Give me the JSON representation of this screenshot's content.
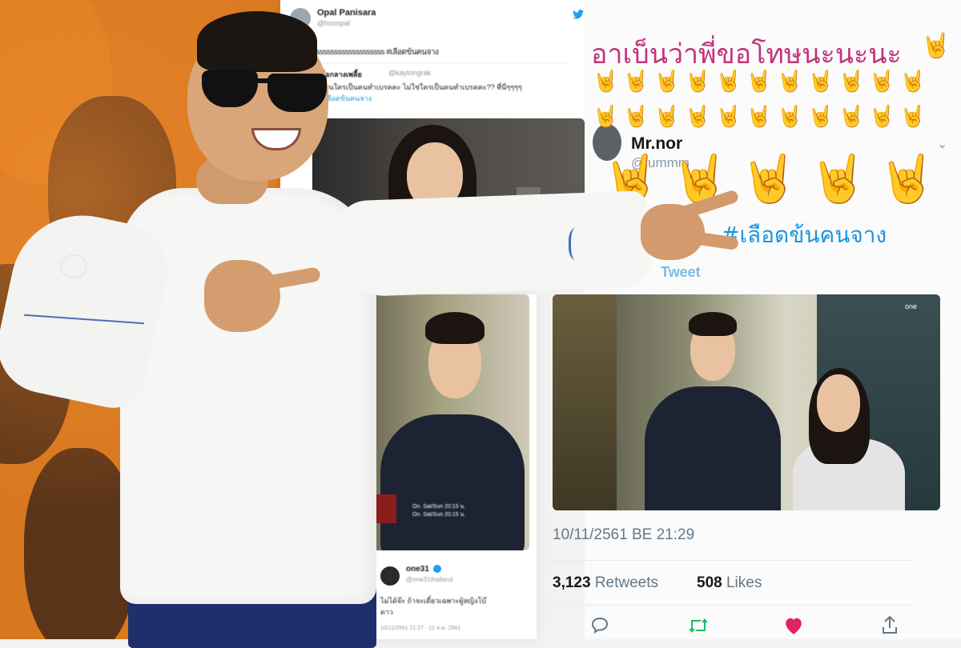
{
  "tweet_top": {
    "author_name": "Opal Panisara",
    "author_handle": "@hooopal",
    "text_line": "ssssssssssssssssssss #เลือดข้นคนจาง",
    "reply_author": "ชื่อกลางเพลี้ย",
    "reply_handle": "@kaytongrak",
    "reply_line1": "ไหนใครเป็นคนทำเบรคคะ ไม่ใช่ใครเป็นคนทำเบรคคะ?? ที่นี่ๆๆๆๆ",
    "reply_line2": "#เลือดข้นคนจาง"
  },
  "tweet_right": {
    "header_text": "อาเบ็นว่าพี่ขอโทษนะนะนะ",
    "author_name": "Mr.nor",
    "author_handle": "@lummm",
    "hashtag": "#เลือดข้นคนจาง",
    "translate": "Tweet",
    "timestamp": "10/11/2561 BE 21:29",
    "retweets_count": "3,123",
    "retweets_label": "Retweets",
    "likes_count": "508",
    "likes_label": "Likes"
  },
  "tweet_mid": {
    "author_name": "one31",
    "author_handle": "@one31thailand",
    "text_line1": "ไม่ได้จ๊ะ ถ้าจะเดี๋ยวเฉพาะผู้หญิงโบ๊",
    "text_line2": "ดาว",
    "footer": "10/11/2561 21:27 · 12 ส.ค. 2561",
    "video_caption1": "On. Sat/Sun 20:15 น.",
    "video_caption2": "On. Sat/Sun 20:15 น.",
    "channel_logo": "one"
  },
  "icons": {
    "twitter_bird": "twitter-bird-icon",
    "reply": "reply-icon",
    "retweet": "retweet-icon",
    "like": "heart-icon",
    "share": "share-icon",
    "verified": "verified-badge-icon",
    "rock_hand": "rock-hand-emoji"
  },
  "colors": {
    "twitter_blue": "#1da1f2",
    "retweet_green": "#17bf63",
    "like_red": "#e0245e",
    "hashtag_blue": "#1b95e0",
    "header_pink": "#c0347c",
    "wall_orange": "#d8781f"
  }
}
